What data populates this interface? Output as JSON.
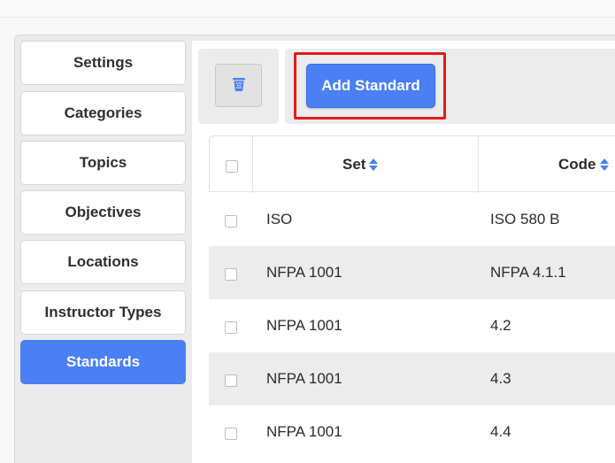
{
  "sidebar": {
    "items": [
      {
        "label": "Settings",
        "active": false
      },
      {
        "label": "Categories",
        "active": false
      },
      {
        "label": "Topics",
        "active": false
      },
      {
        "label": "Objectives",
        "active": false
      },
      {
        "label": "Locations",
        "active": false
      },
      {
        "label": "Instructor Types",
        "active": false
      },
      {
        "label": "Standards",
        "active": true
      }
    ]
  },
  "toolbar": {
    "delete_icon": "trash-icon",
    "add_label": "Add Standard"
  },
  "table": {
    "columns": [
      {
        "label": "Set",
        "sortable": true
      },
      {
        "label": "Code",
        "sortable": true
      }
    ],
    "rows": [
      {
        "set": "ISO",
        "code": "ISO 580 B"
      },
      {
        "set": "NFPA 1001",
        "code": "NFPA 4.1.1"
      },
      {
        "set": "NFPA 1001",
        "code": "4.2"
      },
      {
        "set": "NFPA 1001",
        "code": "4.3"
      },
      {
        "set": "NFPA 1001",
        "code": "4.4"
      }
    ]
  },
  "colors": {
    "accent": "#4a7ff5",
    "highlight": "#e41b1b"
  }
}
